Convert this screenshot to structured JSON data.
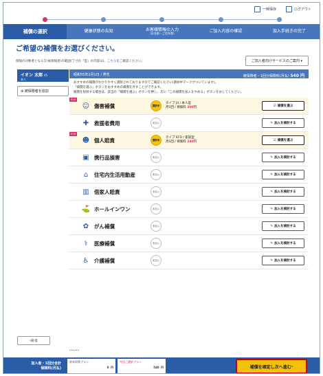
{
  "topbar": {
    "save_label": "一時保存",
    "logout_label": "ログアウト"
  },
  "steps": [
    {
      "label": "補償の選択",
      "sub": ""
    },
    {
      "label": "健康状態の告知",
      "sub": ""
    },
    {
      "label": "お客様情報の入力",
      "sub": "(お名前・ご住所等)"
    },
    {
      "label": "ご加入内容の確認",
      "sub": ""
    },
    {
      "label": "加入手続きの完了",
      "sub": ""
    }
  ],
  "page": {
    "title": "ご希望の補償をお選びください。",
    "note": "保険の対象者となる方(被保険者)の範囲(丁寸の「型」の内容)は、",
    "note_link": "こちら",
    "note_tail": "をご確認ください。",
    "service_button": "ご加入者向けサービスのご案内 ▾"
  },
  "sidebar": {
    "member_name": "イオン 太郎",
    "member_age": "45",
    "member_role": "本人",
    "add_insured": "被保険者を追加"
  },
  "main": {
    "dob": "昭和55年1月1日 / 男性",
    "price_label": "被保険者・1回分保険料(月払)",
    "price_value": "540 円",
    "desc": [
      "おすすめの補償がわかりやすく選択されておりますのでご確認ください(選択中マークがついています)。",
      "「補償を選ぶ」ボタンをおすすめの補償を外すことができます。",
      "補償を削除する場合は、該当の「補償を選ぶ」ボタンを押し、次に「この補償を加入をやめる」ボタンをおしてください。"
    ]
  },
  "rows": [
    {
      "name": "傷害補償",
      "eux": "EUX",
      "status": "選択中",
      "detail1": "タイプ J4 / 本人型",
      "detail2": "月1回 / 保険料",
      "premium": "300円",
      "button": "補償を選ぶ",
      "selected": true,
      "icon": "person-icon"
    },
    {
      "name": "救援者費用",
      "eux": "",
      "status": "未加入",
      "detail1": "",
      "detail2": "",
      "premium": "",
      "button": "加入を検討する",
      "selected": false,
      "icon": "rescue-icon"
    },
    {
      "name": "個人賠責",
      "eux": "EUX",
      "status": "選択中",
      "detail1": "タイプ KFD / 家族型",
      "detail2": "月1回 / 保険料",
      "premium": "240円",
      "button": "補償を選ぶ",
      "selected": true,
      "icon": "liability-icon"
    },
    {
      "name": "携行品損害",
      "eux": "",
      "status": "未加入",
      "detail1": "",
      "detail2": "",
      "premium": "",
      "button": "加入を検討する",
      "selected": false,
      "icon": "bag-icon"
    },
    {
      "name": "住宅内生活用動産",
      "eux": "",
      "status": "未加入",
      "detail1": "",
      "detail2": "",
      "premium": "",
      "button": "加入を検討する",
      "selected": false,
      "icon": "house-icon"
    },
    {
      "name": "借家人賠責",
      "eux": "",
      "status": "未加入",
      "detail1": "",
      "detail2": "",
      "premium": "",
      "button": "加入を検討する",
      "selected": false,
      "icon": "building-icon"
    },
    {
      "name": "ホールインワン",
      "eux": "",
      "status": "未加入",
      "detail1": "",
      "detail2": "",
      "premium": "",
      "button": "加入を検討する",
      "selected": false,
      "icon": "golf-icon"
    },
    {
      "name": "がん補償",
      "eux": "",
      "status": "未加入",
      "detail1": "",
      "detail2": "",
      "premium": "",
      "button": "加入を検討する",
      "selected": false,
      "icon": "flower-icon"
    },
    {
      "name": "医療補償",
      "eux": "",
      "status": "未加入",
      "detail1": "",
      "detail2": "",
      "premium": "",
      "button": "加入を検討する",
      "selected": false,
      "icon": "medical-icon"
    },
    {
      "name": "介護補償",
      "eux": "",
      "status": "未加入",
      "detail1": "",
      "detail2": "",
      "premium": "",
      "button": "加入を検討する",
      "selected": false,
      "icon": "care-icon"
    }
  ],
  "footer": {
    "back": "戻る",
    "title1": "加入者・1回分合計",
    "title2": "保険料(月払)",
    "prev_label": "前年同等プラン",
    "prev_value": "0",
    "cur_label": "今回ご選択プラン",
    "cur_value": "540",
    "unit": "円",
    "confirm": "補償を確定し次へ進む"
  },
  "colors": {
    "primary": "#2b5ca7",
    "accent": "#d6336c",
    "highlight": "#f4c20d"
  }
}
